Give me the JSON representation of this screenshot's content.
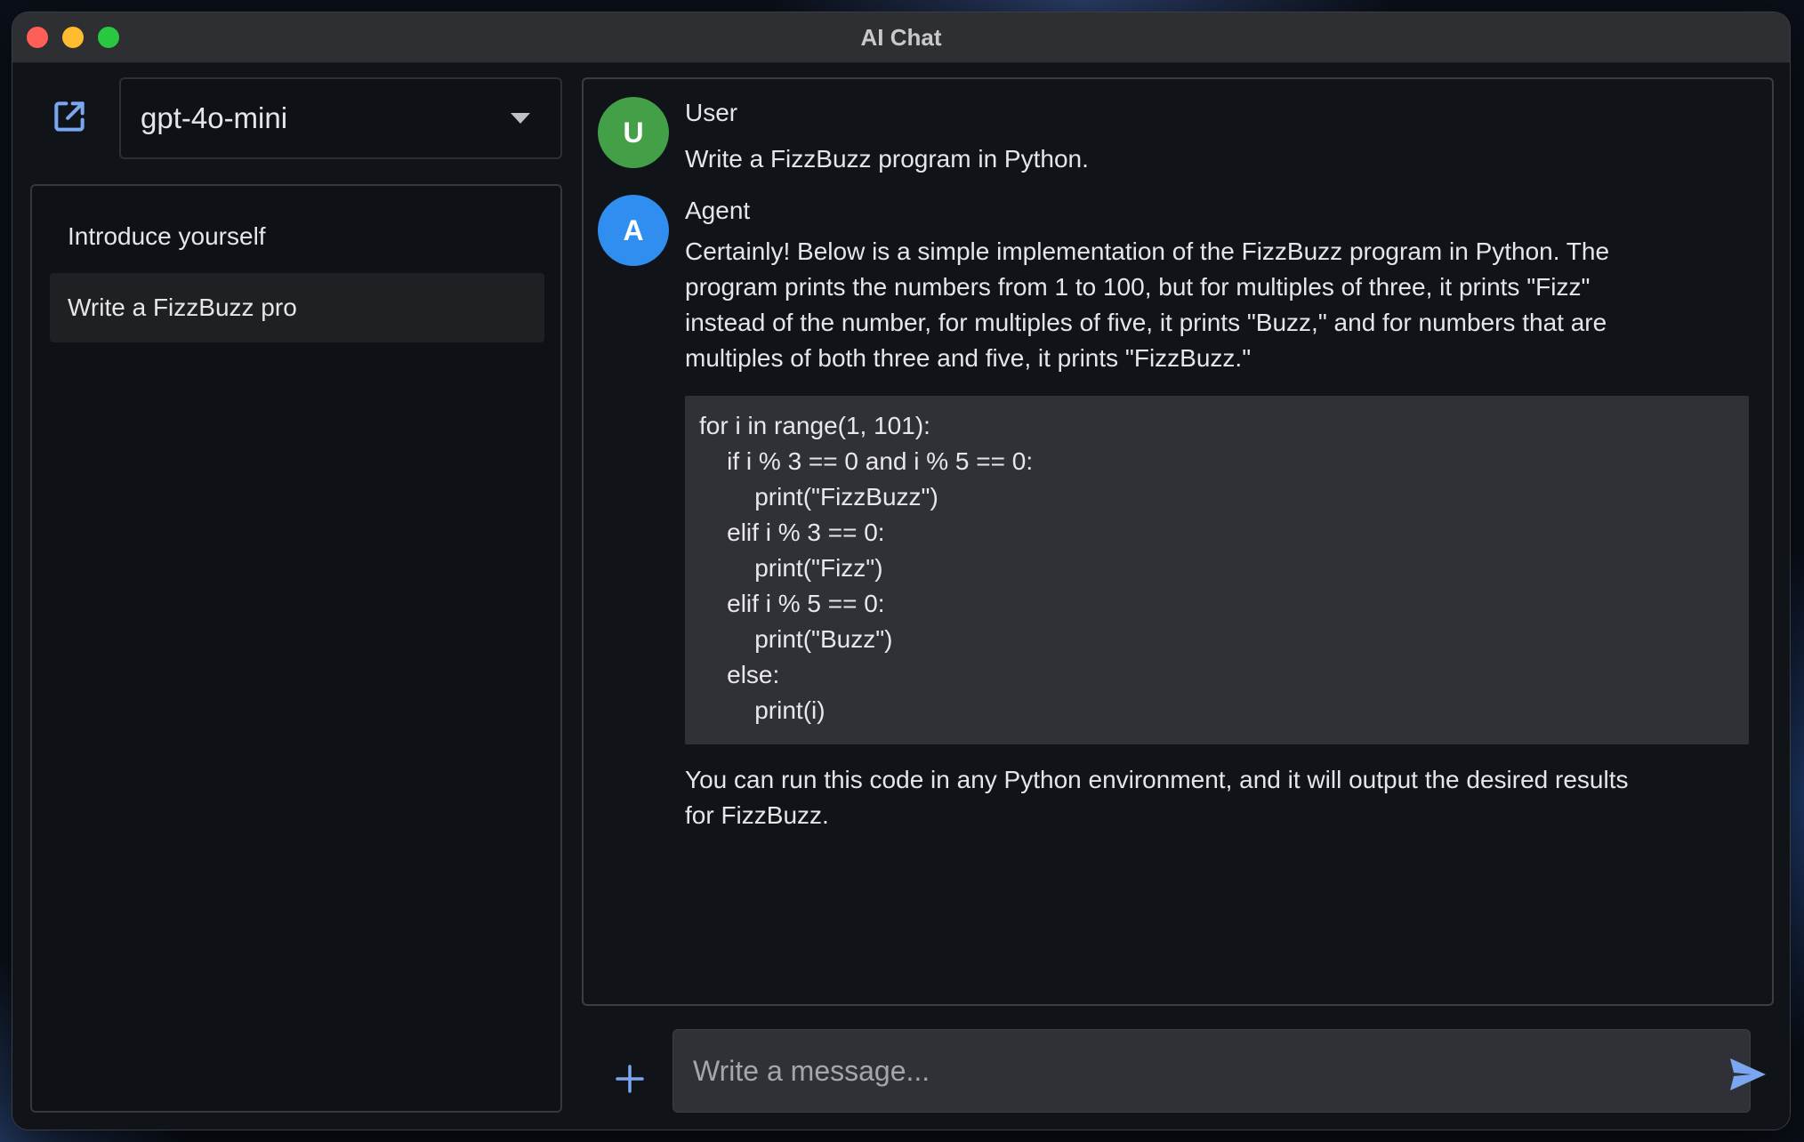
{
  "window": {
    "title": "AI Chat"
  },
  "sidebar": {
    "model_selected": "gpt-4o-mini",
    "history": [
      {
        "label": "Introduce yourself",
        "active": false
      },
      {
        "label": "Write a FizzBuzz pro",
        "active": true
      }
    ]
  },
  "chat": {
    "messages": [
      {
        "avatar": "U",
        "avatar_color": "#43a047",
        "author": "User",
        "text": "Write a FizzBuzz program in Python."
      },
      {
        "avatar": "A",
        "avatar_color": "#2f8ef0",
        "author": "Agent",
        "intro_lines": [
          "Certainly! Below is a simple implementation of the FizzBuzz program in Python. The",
          "program prints the numbers from 1 to 100, but for multiples of three, it prints \"Fizz\"",
          "instead of the number, for multiples of five, it prints \"Buzz,\" and for numbers that are",
          "multiples of both three and five, it prints \"FizzBuzz.\""
        ],
        "code_lines": [
          "for i in range(1, 101):",
          "    if i % 3 == 0 and i % 5 == 0:",
          "        print(\"FizzBuzz\")",
          "    elif i % 3 == 0:",
          "        print(\"Fizz\")",
          "    elif i % 5 == 0:",
          "        print(\"Buzz\")",
          "    else:",
          "        print(i)"
        ],
        "outro_lines": [
          "You can run this code in any Python environment, and it will output the desired results",
          "for FizzBuzz."
        ]
      }
    ]
  },
  "composer": {
    "placeholder": "Write a message...",
    "value": ""
  },
  "icons": {
    "new_chat": "open-in-new-icon",
    "model_dropdown": "caret-down-icon",
    "attach": "plus-icon",
    "send": "send-icon"
  },
  "colors": {
    "accent": "#7aa7f0",
    "user_avatar": "#43a047",
    "agent_avatar": "#2f8ef0",
    "close": "#fe5f57",
    "minimize": "#febc2e",
    "maximize": "#28c840"
  }
}
